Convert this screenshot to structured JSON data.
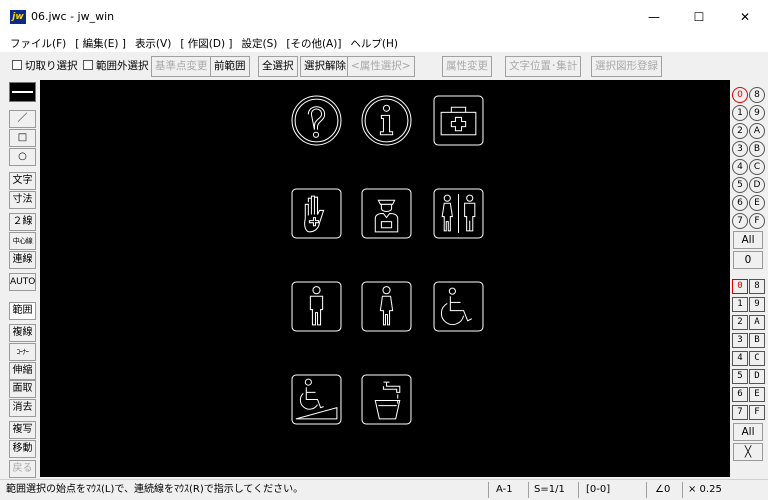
{
  "window": {
    "title": "06.jwc - jw_win",
    "app_icon_text": "jw",
    "minimize": "—",
    "maximize": "☐",
    "close": "✕"
  },
  "menu": [
    "ファイル(F)",
    "[ 編集(E) ]",
    "表示(V)",
    "[ 作図(D) ]",
    "設定(S)",
    "[その他(A)]",
    "ヘルプ(H)"
  ],
  "toolbar": {
    "cut_select": "切取り選択",
    "outside_select": "範囲外選択",
    "base_point_change": "基準点変更",
    "prev_range": "前範囲",
    "select_all": "全選択",
    "deselect": "選択解除",
    "attr_select": "<属性選択>",
    "attr_change": "属性変更",
    "text_pos_count": "文字位置･集計",
    "register_shape": "選択図形登録"
  },
  "left_tools": {
    "line": "／",
    "rect": "□",
    "circle": "○",
    "text": "文字",
    "dimension": "寸法",
    "double_line": "２線",
    "center_line": "中心線",
    "continuous_line": "連線",
    "auto": "AUTO",
    "range": "範囲",
    "multi_line": "複線",
    "corner": "ｺｰﾅｰ",
    "extend": "伸縮",
    "chamfer": "面取",
    "erase": "消去",
    "copy": "複写",
    "move": "移動",
    "undo": "戻る"
  },
  "layers": [
    "0",
    "8",
    "1",
    "9",
    "2",
    "A",
    "3",
    "B",
    "4",
    "C",
    "5",
    "D",
    "6",
    "E",
    "7",
    "F"
  ],
  "layer_all": "All",
  "layer_current": "0",
  "groups": [
    "0",
    "8",
    "1",
    "9",
    "2",
    "A",
    "3",
    "B",
    "4",
    "C",
    "5",
    "D",
    "6",
    "E",
    "7",
    "F"
  ],
  "group_all": "All",
  "group_x": "╳",
  "status": {
    "message": "範囲選択の始点をﾏｳｽ(L)で、連続線をﾏｳｽ(R)で指示してください。",
    "paper": "A-1",
    "scale": "S=1/1",
    "layer_code": "[0-0]",
    "angle": "∠0",
    "zoom": "× 0.25"
  },
  "symbols": [
    "question-icon",
    "info-icon",
    "first-aid-icon",
    "stop-hand-icon",
    "police-icon",
    "restroom-icon",
    "mens-restroom-icon",
    "womens-restroom-icon",
    "wheelchair-icon",
    "wheelchair-ramp-icon",
    "drinking-water-icon"
  ]
}
